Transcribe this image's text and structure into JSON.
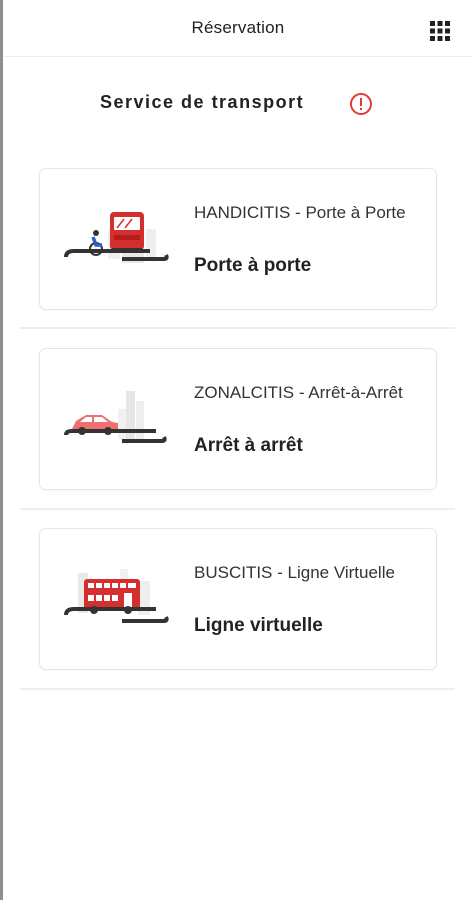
{
  "header": {
    "title": "Réservation",
    "apps_icon": "apps-grid-icon"
  },
  "section": {
    "title": "Service de transport",
    "info_icon": "info-circle-icon",
    "accent_color": "#e53935"
  },
  "services": [
    {
      "name": "HANDICITIS - Porte à Porte",
      "type": "Porte à porte",
      "illustration": "wheelchair-bus-illustration"
    },
    {
      "name": "ZONALCITIS - Arrêt-à-Arrêt",
      "type": "Arrêt à arrêt",
      "illustration": "car-illustration"
    },
    {
      "name": "BUSCITIS - Ligne Virtuelle",
      "type": "Ligne virtuelle",
      "illustration": "double-decker-bus-illustration"
    }
  ]
}
